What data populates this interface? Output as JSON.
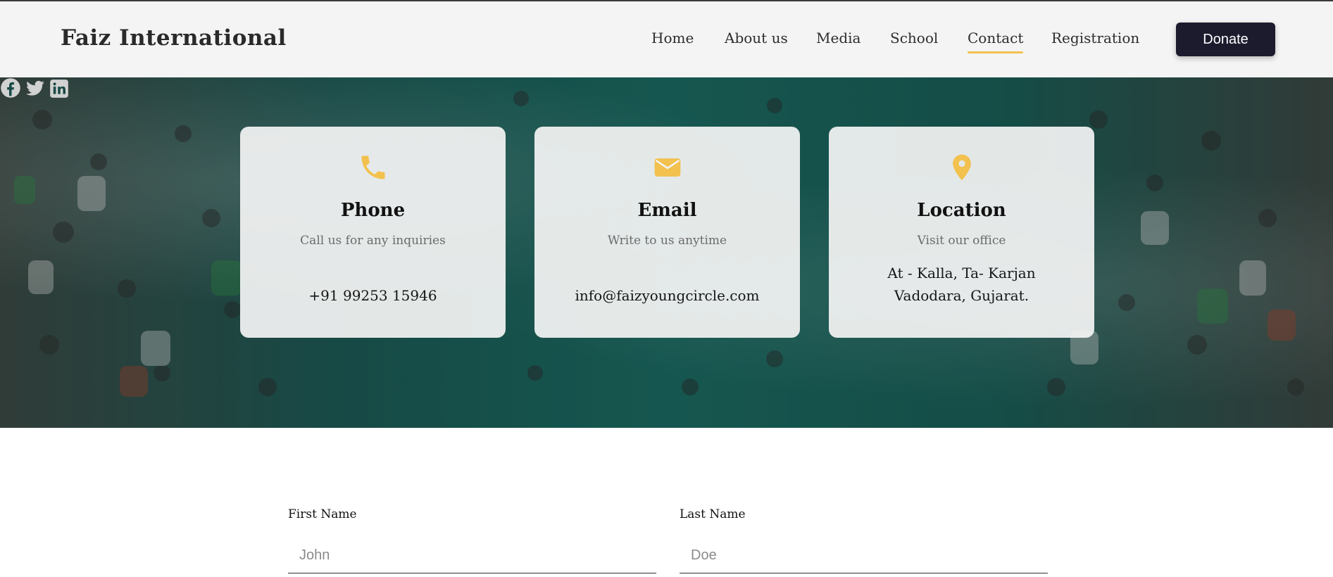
{
  "header": {
    "brand": "Faiz International",
    "nav": [
      "Home",
      "About us",
      "Media",
      "School",
      "Contact",
      "Registration"
    ],
    "active_nav": "Contact",
    "donate_label": "Donate"
  },
  "cards": [
    {
      "icon": "phone-icon",
      "title": "Phone",
      "subtitle": "Call us for any inquiries",
      "value_lines": [
        "+91 99253 15946"
      ]
    },
    {
      "icon": "envelope-icon",
      "title": "Email",
      "subtitle": "Write to us anytime",
      "value_lines": [
        "info@faizyoungcircle.com"
      ]
    },
    {
      "icon": "location-pin-icon",
      "title": "Location",
      "subtitle": "Visit our office",
      "value_lines": [
        "At - Kalla, Ta- Karjan",
        "Vadodara, Gujarat."
      ]
    }
  ],
  "social": [
    "facebook-icon",
    "twitter-icon",
    "linkedin-icon"
  ],
  "form": {
    "first_name": {
      "label": "First Name",
      "placeholder": "John",
      "value": ""
    },
    "last_name": {
      "label": "Last Name",
      "placeholder": "Doe",
      "value": ""
    }
  },
  "colors": {
    "accent": "#f2c14e",
    "donate_bg": "#1c1b2e",
    "header_bg": "#f4f4f4",
    "hero_teal": "#1b6a62"
  }
}
